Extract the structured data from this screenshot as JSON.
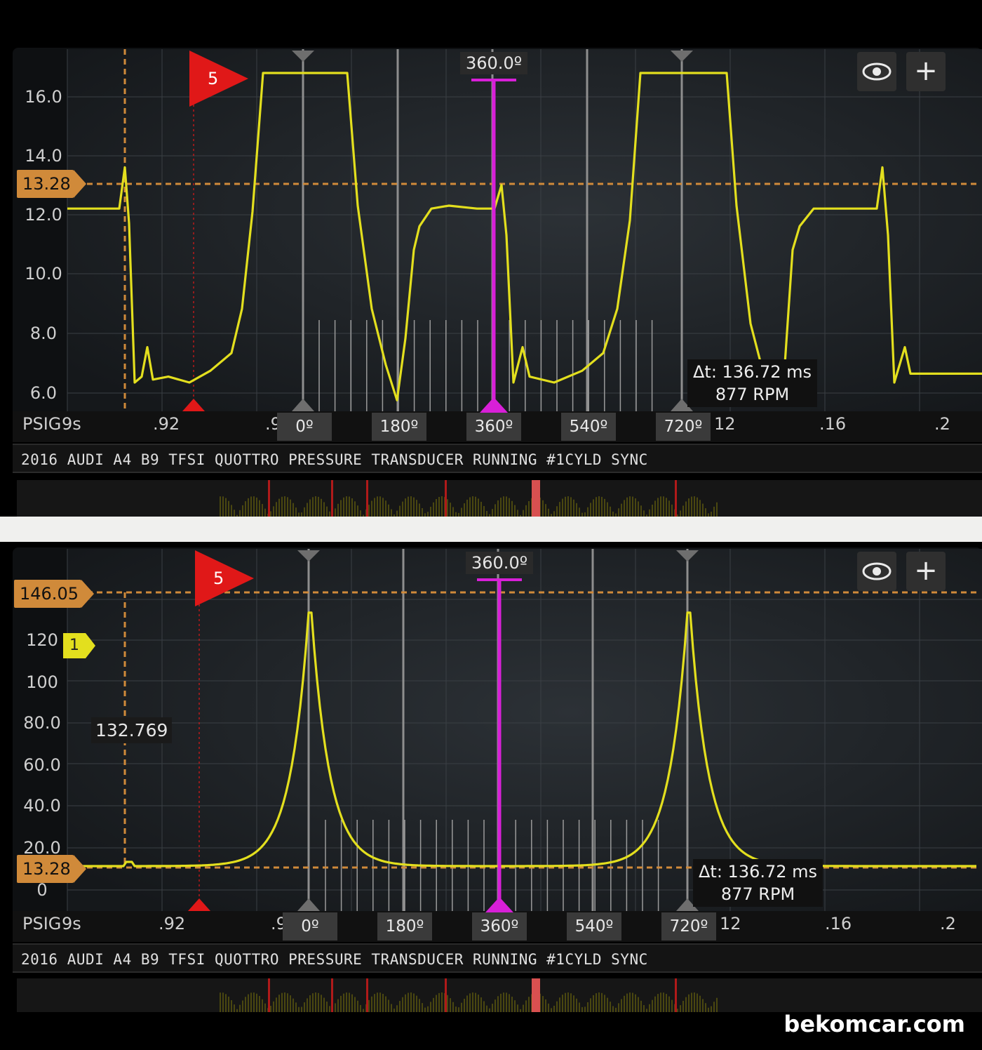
{
  "watermark": "bekomcar.com",
  "colors": {
    "trace": "#e3df1e",
    "cursor": "#d81fd8",
    "marker": "#d08a3a",
    "flag": "#e01818"
  },
  "icons": {
    "eye": "eye-icon",
    "plus": "plus-icon"
  },
  "panels": [
    {
      "id": "top",
      "title": "2016 AUDI A4 B9 TFSI QUOTTRO PRESSURE TRANSDUCER RUNNING #1CYLD SYNC",
      "y_labels": [
        "16.0",
        "14.0",
        "12.0",
        "10.0",
        "8.0",
        "6.0"
      ],
      "y_unit": "PSIG",
      "x_labels": [
        "9s",
        ".92",
        ".9",
        "12",
        ".16",
        ".2"
      ],
      "degree_labels": [
        "0º",
        "180º",
        "360º",
        "540º",
        "720º"
      ],
      "cursor_label": "360.0º",
      "level_badge": "13.28",
      "flag_label": "5",
      "delta_t": "Δt: 136.72 ms",
      "rpm": "877 RPM",
      "plus_label": "+"
    },
    {
      "id": "bottom",
      "title": "2016 AUDI A4 B9 TFSI QUOTTRO PRESSURE TRANSDUCER RUNNING #1CYLD SYNC",
      "y_labels": [
        "120",
        "100",
        "80.0",
        "60.0",
        "40.0",
        "20.0",
        "0"
      ],
      "y_unit": "PSIG",
      "x_labels": [
        "9s",
        ".92",
        ".9",
        "12",
        ".16",
        ".2"
      ],
      "degree_labels": [
        "0º",
        "180º",
        "360º",
        "540º",
        "720º"
      ],
      "cursor_label": "360.0º",
      "level_badge_top": "146.05",
      "level_badge_bottom": "13.28",
      "channel_marker": "1",
      "value_readout": "132.769",
      "flag_label": "5",
      "delta_t": "Δt: 136.72 ms",
      "rpm": "877 RPM",
      "plus_label": "+"
    }
  ]
}
